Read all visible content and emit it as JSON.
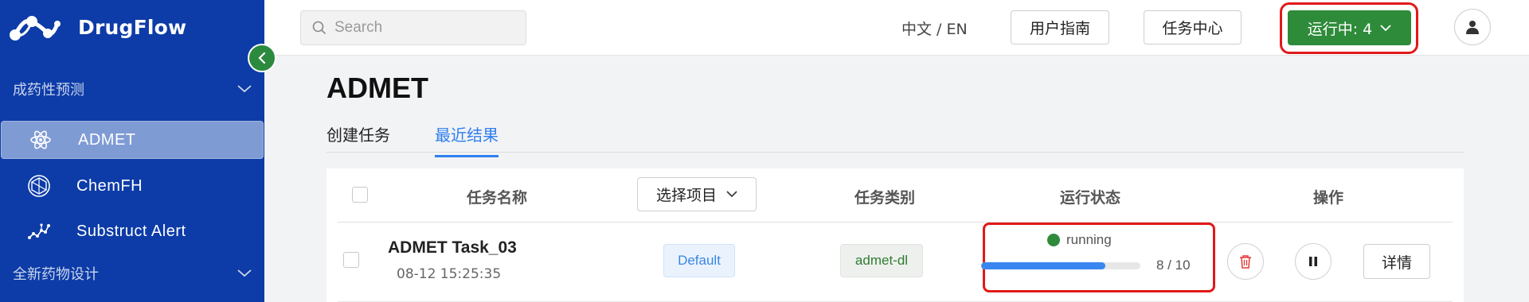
{
  "app": {
    "name": "DrugFlow"
  },
  "sidebar": {
    "groups": [
      {
        "label": "成药性预测"
      },
      {
        "label": "全新药物设计"
      }
    ],
    "items": [
      {
        "label": "ADMET",
        "icon": "atom-icon",
        "active": true
      },
      {
        "label": "ChemFH",
        "icon": "hexagon-icon",
        "active": false
      },
      {
        "label": "Substruct Alert",
        "icon": "molecule-icon",
        "active": false
      }
    ]
  },
  "header": {
    "search_placeholder": "Search",
    "language": "中文 / EN",
    "guide_label": "用户指南",
    "task_center_label": "任务中心",
    "running_label": "运行中: 4"
  },
  "page": {
    "title": "ADMET",
    "tabs": [
      {
        "label": "创建任务",
        "active": false
      },
      {
        "label": "最近结果",
        "active": true
      }
    ]
  },
  "table": {
    "columns": {
      "name": "任务名称",
      "project_select": "选择项目",
      "type": "任务类别",
      "status": "运行状态",
      "actions": "操作"
    },
    "rows": [
      {
        "name": "ADMET Task_03",
        "time": "08-12 15:25:35",
        "project": "Default",
        "type": "admet-dl",
        "status": "running",
        "progress_text": "8 / 10",
        "progress_fraction": 0.78,
        "detail_label": "详情"
      }
    ]
  },
  "colors": {
    "sidebar_bg": "#0d3ca8",
    "accent_blue": "#2f7ff0",
    "running_green": "#2e8b3a",
    "highlight_red": "#e11919"
  }
}
